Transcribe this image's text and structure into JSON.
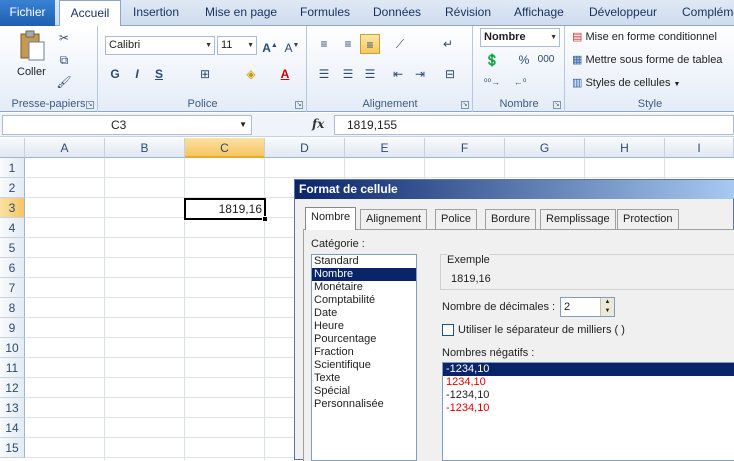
{
  "ribbon_tabs": [
    "Fichier",
    "Accueil",
    "Insertion",
    "Mise en page",
    "Formules",
    "Données",
    "Révision",
    "Affichage",
    "Développeur",
    "Compléme"
  ],
  "clipboard": {
    "paste_label": "Coller",
    "group_label": "Presse-papiers"
  },
  "font": {
    "name": "Calibri",
    "size": "11",
    "bold": "G",
    "italic": "I",
    "underline": "S",
    "group_label": "Police"
  },
  "alignment": {
    "group_label": "Alignement"
  },
  "number": {
    "format": "Nombre",
    "group_label": "Nombre",
    "percent": "%",
    "thousands": "000"
  },
  "styles": {
    "conditional": "Mise en forme conditionnel",
    "table": "Mettre sous forme de tablea",
    "cell_styles": "Styles de cellules",
    "group_label": "Style"
  },
  "formula_bar": {
    "name_box": "C3",
    "fx": "fx",
    "formula": "1819,155"
  },
  "grid": {
    "columns": [
      "A",
      "B",
      "C",
      "D",
      "E",
      "F",
      "G",
      "H",
      "I"
    ],
    "rows": [
      "1",
      "2",
      "3",
      "4",
      "5",
      "6",
      "7",
      "8",
      "9",
      "10",
      "11",
      "12",
      "13",
      "14",
      "15"
    ],
    "selected_cell_value": "1819,16"
  },
  "dialog": {
    "title": "Format de cellule",
    "tabs": [
      "Nombre",
      "Alignement",
      "Police",
      "Bordure",
      "Remplissage",
      "Protection"
    ],
    "category_label": "Catégorie :",
    "categories": [
      "Standard",
      "Nombre",
      "Monétaire",
      "Comptabilité",
      "Date",
      "Heure",
      "Pourcentage",
      "Fraction",
      "Scientifique",
      "Texte",
      "Spécial",
      "Personnalisée"
    ],
    "selected_category": "Nombre",
    "example_label": "Exemple",
    "example_value": "1819,16",
    "decimals_label": "Nombre de décimales :",
    "decimals_value": "2",
    "separator_label": "Utiliser le séparateur de milliers ( )",
    "separator_checked": false,
    "negative_label": "Nombres négatifs :",
    "negative_formats": [
      {
        "text": "-1234,10",
        "red": false,
        "selected": true
      },
      {
        "text": "1234,10",
        "red": true,
        "selected": false
      },
      {
        "text": "-1234,10",
        "red": false,
        "selected": false
      },
      {
        "text": "-1234,10",
        "red": true,
        "selected": false
      }
    ]
  }
}
